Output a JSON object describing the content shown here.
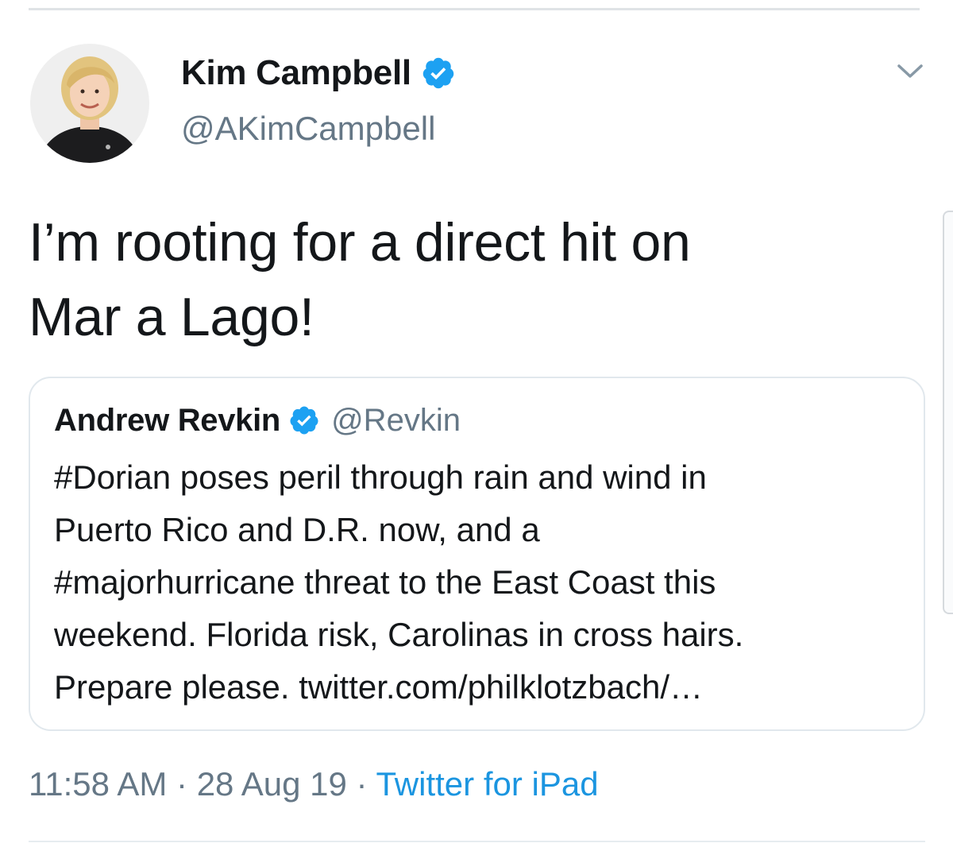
{
  "tweet": {
    "author": {
      "display_name": "Kim Campbell",
      "handle": "@AKimCampbell",
      "verified": true
    },
    "text_line1": "I’m rooting for a direct hit on",
    "text_line2": "Mar a Lago!",
    "quoted_tweet": {
      "display_name": "Andrew Revkin",
      "handle": "@Revkin",
      "verified": true,
      "lines": [
        "#Dorian poses peril through rain and wind in",
        "Puerto Rico and D.R. now, and a",
        "#majorhurricane threat to the East Coast this",
        "weekend. Florida risk, Carolinas in cross hairs.",
        "Prepare please. twitter.com/philklotzbach/…"
      ]
    },
    "meta": {
      "time": "11:58 AM",
      "separator": "·",
      "date": "28 Aug 19",
      "source": "Twitter for iPad"
    }
  },
  "icons": {
    "verified": "verified-badge-icon",
    "more": "chevron-down-icon"
  },
  "colors": {
    "text": "#14171a",
    "secondary": "#657786",
    "link": "#1b95e0",
    "verified": "#1da1f2",
    "border": "#e1e8ed"
  }
}
